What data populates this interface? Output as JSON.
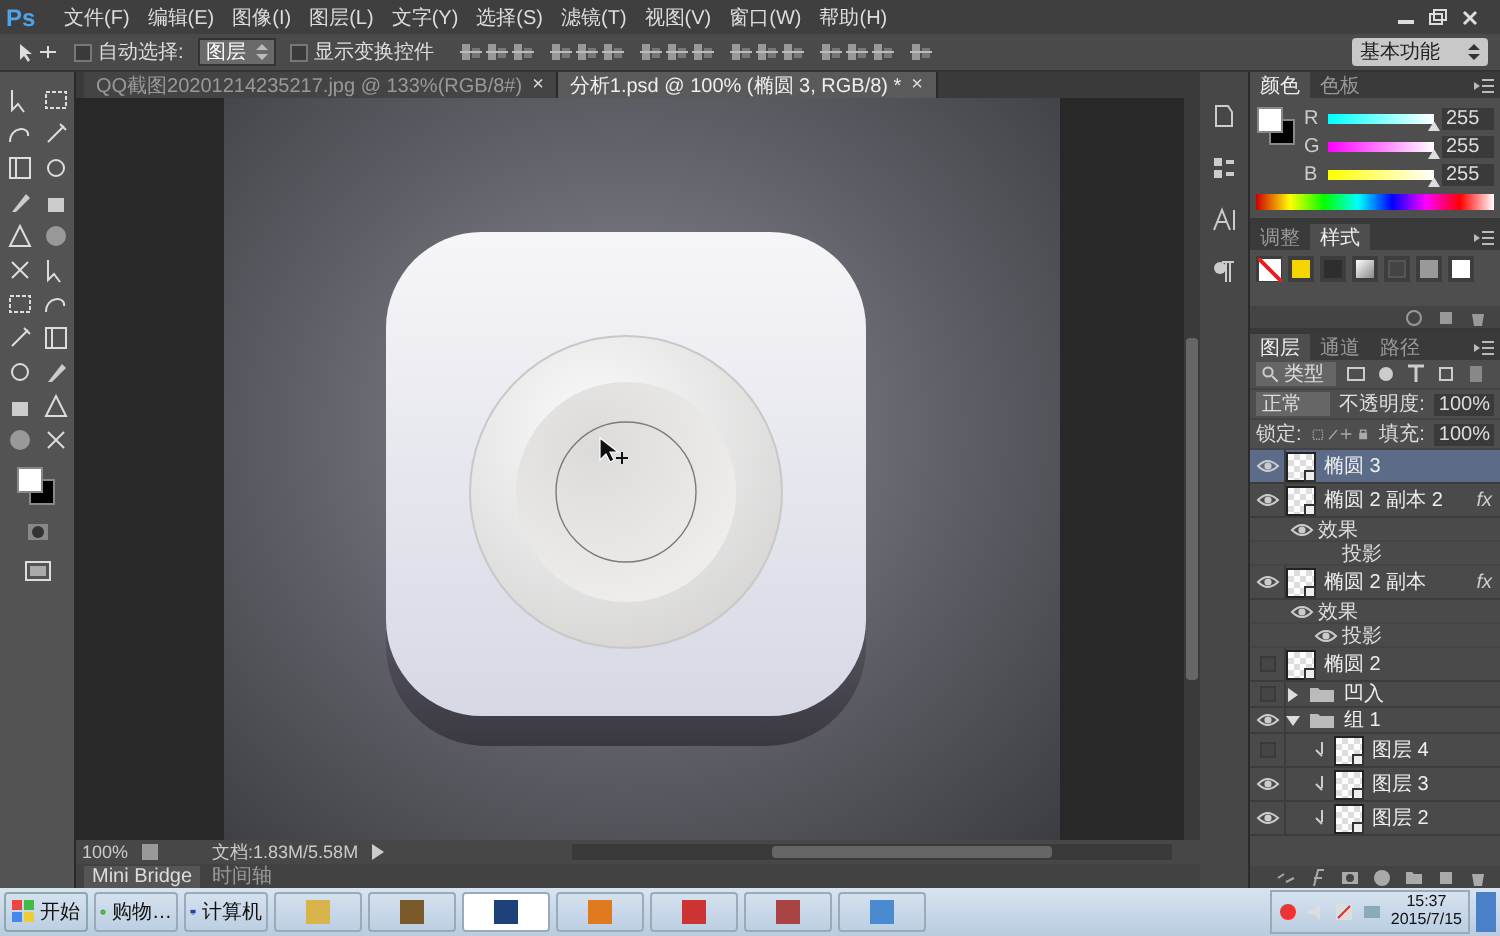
{
  "app": {
    "logo": "Ps",
    "menus": [
      "文件(F)",
      "编辑(E)",
      "图像(I)",
      "图层(L)",
      "文字(Y)",
      "选择(S)",
      "滤镜(T)",
      "视图(V)",
      "窗口(W)",
      "帮助(H)"
    ]
  },
  "options": {
    "auto_select": {
      "label": "自动选择:",
      "checked": false
    },
    "target": "图层",
    "transform": {
      "label": "显示变换控件",
      "checked": false
    },
    "workspace": "基本功能"
  },
  "tabs": [
    {
      "label": "QQ截图20201214235217.jpg @ 133%(RGB/8#)",
      "selected": false,
      "close": "×"
    },
    {
      "label": "分析1.psd @ 100% (椭圆 3, RGB/8) *",
      "selected": true,
      "close": "×"
    }
  ],
  "status_bar": {
    "zoom": "100%",
    "document": "文档:1.83M/5.58M"
  },
  "bottom_tabs": [
    {
      "label": "Mini Bridge",
      "selected": true
    },
    {
      "label": "时间轴",
      "selected": false
    }
  ],
  "color_panel": {
    "tabs": [
      {
        "label": "颜色",
        "selected": true
      },
      {
        "label": "色板",
        "selected": false
      }
    ],
    "channels": [
      {
        "label": "R",
        "level": 1,
        "reading": "255"
      },
      {
        "label": "G",
        "level": 1,
        "reading": "255"
      },
      {
        "label": "B",
        "level": 1,
        "reading": "255"
      }
    ]
  },
  "styles_panel": {
    "tabs": [
      {
        "label": "调整",
        "selected": false
      },
      {
        "label": "样式",
        "selected": true
      }
    ]
  },
  "layers_panel": {
    "tabs": [
      {
        "label": "图层",
        "selected": true
      },
      {
        "label": "通道",
        "selected": false
      },
      {
        "label": "路径",
        "selected": false
      }
    ],
    "filter": "类型",
    "blend": "正常",
    "opacity_label": "不透明度:",
    "opacity": "100%",
    "lock_label": "锁定:",
    "fill_label": "填充:",
    "fill": "100%",
    "items": [
      {
        "kind": "layer",
        "name": "椭圆 3",
        "visible": true,
        "selected": true
      },
      {
        "kind": "layer",
        "name": "椭圆 2 副本 2",
        "visible": true,
        "selected": false,
        "fx": "fx",
        "effects": {
          "label": "效果",
          "visible": true,
          "items": [
            {
              "label": "投影",
              "visible": false
            }
          ]
        }
      },
      {
        "kind": "layer",
        "name": "椭圆 2 副本",
        "visible": true,
        "selected": false,
        "fx": "fx",
        "effects": {
          "label": "效果",
          "visible": true,
          "items": [
            {
              "label": "投影",
              "visible": true
            }
          ]
        }
      },
      {
        "kind": "layer",
        "name": "椭圆 2",
        "visible": false,
        "selected": false
      },
      {
        "kind": "group",
        "name": "凹入",
        "visible": false,
        "selected": false,
        "expanded": false
      },
      {
        "kind": "group",
        "name": "组 1",
        "visible": true,
        "selected": false,
        "expanded": true,
        "children": [
          {
            "kind": "layer",
            "name": "图层 4",
            "visible": false,
            "selected": false,
            "clipped": true
          },
          {
            "kind": "layer",
            "name": "图层 3",
            "visible": true,
            "selected": false,
            "clipped": true
          },
          {
            "kind": "layer",
            "name": "图层 2",
            "visible": true,
            "selected": false,
            "clipped": true
          }
        ]
      }
    ]
  },
  "taskbar": {
    "start": "开始",
    "buttons": [
      {
        "label": "购物…"
      },
      {
        "label": "计算机"
      }
    ],
    "clock": {
      "time": "15:37",
      "date": "2015/7/15"
    }
  }
}
